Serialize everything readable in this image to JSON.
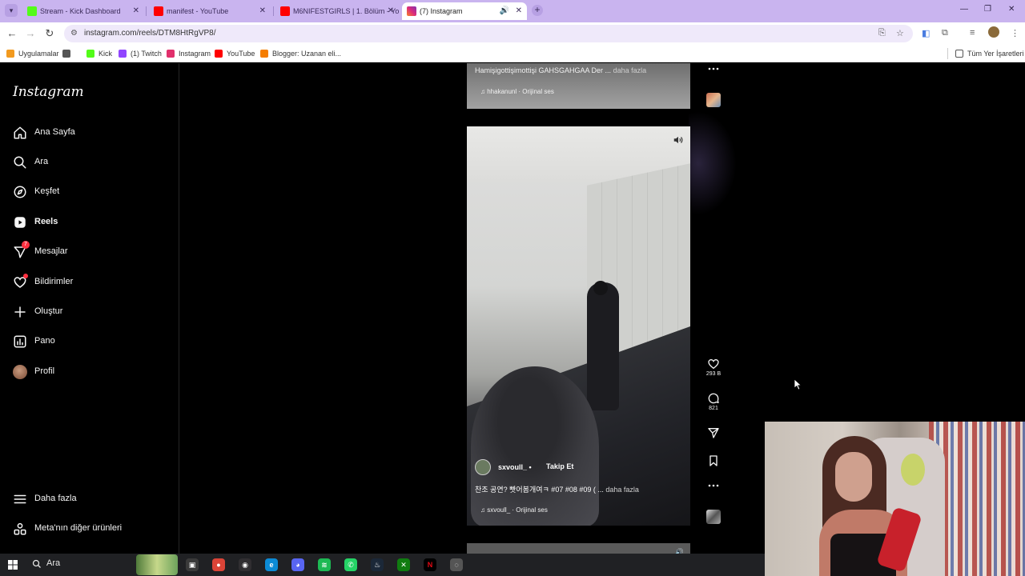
{
  "browser": {
    "tabs": [
      {
        "title": "Stream - Kick Dashboard",
        "favicon_color": "#53fc18",
        "active": false
      },
      {
        "title": "manifest - YouTube",
        "favicon_color": "#ff0000",
        "active": false
      },
      {
        "title": "M6NIFESTGIRLS | 1. Bölüm - Yo",
        "favicon_color": "#ff0000",
        "active": false
      },
      {
        "title": "(7) Instagram",
        "favicon_color": "#e1306c",
        "active": true
      }
    ],
    "url": "instagram.com/reels/DTM8HtRgVP8/",
    "bookmarks": [
      {
        "label": "Uygulamalar",
        "color": "#f29a1f"
      },
      {
        "label": "",
        "color": "#555555"
      },
      {
        "label": "Kick",
        "color": "#53fc18"
      },
      {
        "label": "(1) Twitch",
        "color": "#9146ff"
      },
      {
        "label": "Instagram",
        "color": "#e1306c"
      },
      {
        "label": "YouTube",
        "color": "#ff0000"
      },
      {
        "label": "Blogger: Uzanan eli...",
        "color": "#f57d00"
      }
    ],
    "all_bookmarks": "Tüm Yer İşaretleri"
  },
  "sidebar": {
    "logo": "Instagram",
    "items": [
      {
        "label": "Ana Sayfa",
        "icon": "home-icon",
        "bold": false
      },
      {
        "label": "Ara",
        "icon": "search-icon",
        "bold": false
      },
      {
        "label": "Keşfet",
        "icon": "compass-icon",
        "bold": false
      },
      {
        "label": "Reels",
        "icon": "reels-icon",
        "bold": true
      },
      {
        "label": "Mesajlar",
        "icon": "messenger-icon",
        "bold": false,
        "badge": "7"
      },
      {
        "label": "Bildirimler",
        "icon": "heart-icon",
        "bold": false
      },
      {
        "label": "Oluştur",
        "icon": "plus-icon",
        "bold": false
      },
      {
        "label": "Pano",
        "icon": "dashboard-icon",
        "bold": false
      },
      {
        "label": "Profil",
        "icon": "avatar-icon",
        "bold": false
      }
    ],
    "more": "Daha fazla",
    "meta": "Meta'nın diğer ürünleri"
  },
  "prev_reel": {
    "caption": "Hamişigottişimottişi GAHSGAHGAA Der ...",
    "more": "daha fazla",
    "audio": "hhakanunl · Orijinal ses"
  },
  "reel": {
    "username": "sxvoull_",
    "separator": "•",
    "follow": "Takip Et",
    "caption": "찬조 공연? 빳어봄개여ㅋ #07 #08 #09 ( ...",
    "more": "daha fazla",
    "audio": "sxvoull_ · Orijinal ses",
    "likes": "293 B",
    "comments": "821"
  },
  "taskbar": {
    "search": "Ara",
    "apps": [
      {
        "name": "task-view-icon",
        "color": "#3a3a3a",
        "glyph": "▣"
      },
      {
        "name": "chrome-icon",
        "color": "#db4437",
        "glyph": "●"
      },
      {
        "name": "obs-icon",
        "color": "#302e31",
        "glyph": "◉"
      },
      {
        "name": "edge-icon",
        "color": "#0c8bd6",
        "glyph": "e"
      },
      {
        "name": "discord-icon",
        "color": "#5865f2",
        "glyph": "◕"
      },
      {
        "name": "spotify-icon",
        "color": "#1db954",
        "glyph": "≋"
      },
      {
        "name": "whatsapp-icon",
        "color": "#25d366",
        "glyph": "✆"
      },
      {
        "name": "steam-icon",
        "color": "#1b2838",
        "glyph": "♨"
      },
      {
        "name": "xbox-icon",
        "color": "#107c10",
        "glyph": "✕"
      },
      {
        "name": "netflix-icon",
        "color": "#000000",
        "glyph": "N"
      },
      {
        "name": "app-icon",
        "color": "#555555",
        "glyph": "◌"
      }
    ]
  }
}
